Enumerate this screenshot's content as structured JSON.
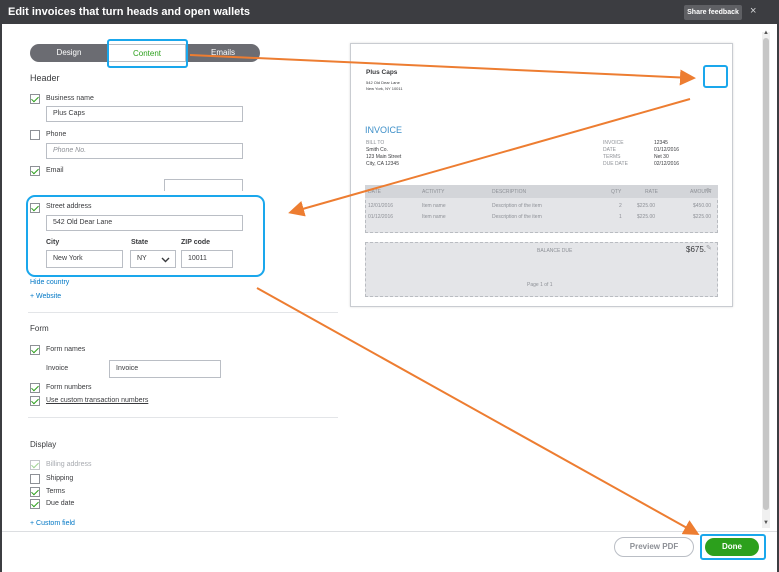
{
  "window": {
    "title": "Edit invoices that turn heads and open wallets",
    "share_label": "Share feedback",
    "close_icon": "×"
  },
  "tabs": {
    "design": "Design",
    "content": "Content",
    "emails": "Emails"
  },
  "header": {
    "section_label": "Header",
    "business_name_label": "Business name",
    "business_name_value": "Plus Caps",
    "phone_label": "Phone",
    "phone_placeholder": "Phone No.",
    "email_label": "Email",
    "street_label": "Street address",
    "street_value": "542  Old Dear Lane",
    "city_label": "City",
    "city_value": "New York",
    "state_label": "State",
    "state_value": "NY",
    "zip_label": "ZIP code",
    "zip_value": "10011",
    "hide_country": "Hide country",
    "add_website": "+ Website"
  },
  "form": {
    "section_label": "Form",
    "form_names_label": "Form names",
    "invoice_label": "Invoice",
    "invoice_value": "Invoice",
    "form_numbers_label": "Form numbers",
    "custom_numbers_label": "Use custom transaction numbers"
  },
  "display": {
    "section_label": "Display",
    "billing_address": "Billing address",
    "shipping": "Shipping",
    "terms": "Terms",
    "due_date": "Due date",
    "custom_field": "+ Custom field"
  },
  "preview": {
    "company": "Plus Caps",
    "address1": "542  Old Dear Lane",
    "address2": "New York, NY 10011",
    "doc_title": "INVOICE",
    "bill_to_label": "BILL TO",
    "bill_to_name": "Smith Co.",
    "bill_to_street": "123 Main Street",
    "bill_to_city": "City, CA 12345",
    "meta_labels": [
      "INVOICE",
      "DATE",
      "TERMS",
      "DUE DATE"
    ],
    "meta_values": [
      "12345",
      "01/12/2016",
      "Net 30",
      "02/12/2016"
    ],
    "columns": [
      "DATE",
      "ACTIVITY",
      "DESCRIPTION",
      "QTY",
      "RATE",
      "AMOUNT"
    ],
    "rows": [
      [
        "12/01/2016",
        "Item name",
        "Description of the item",
        "2",
        "$225.00",
        "$450.00"
      ],
      [
        "01/12/2016",
        "Item name",
        "Description of the item",
        "1",
        "$225.00",
        "$225.00"
      ]
    ],
    "balance_due_label": "BALANCE DUE",
    "balance_due_value": "$675.",
    "page_label": "Page 1 of 1"
  },
  "footer": {
    "preview_pdf": "Preview PDF",
    "done": "Done"
  }
}
